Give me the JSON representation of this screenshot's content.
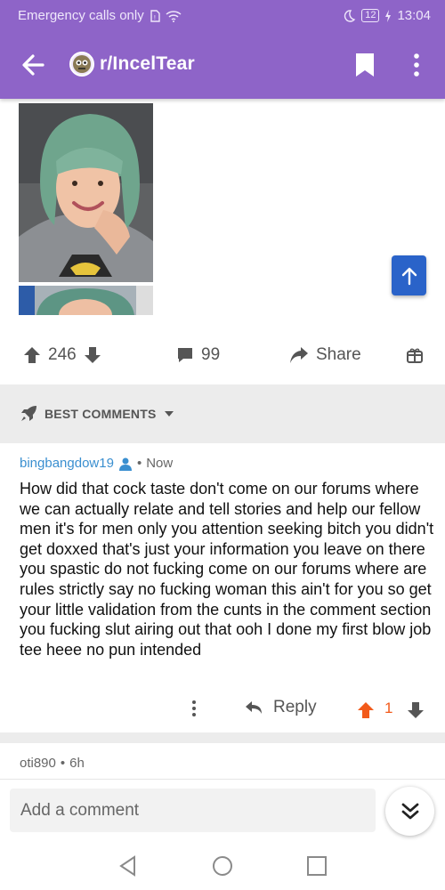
{
  "status_bar": {
    "carrier": "Emergency calls only",
    "battery": "12",
    "time": "13:04"
  },
  "header": {
    "subreddit": "r/IncelTear",
    "accent_color": "#8e64c8"
  },
  "post": {
    "upvotes": "246",
    "comments": "99",
    "share_label": "Share"
  },
  "sort": {
    "label": "BEST COMMENTS"
  },
  "comments": [
    {
      "author": "bingbangdow19",
      "time": "Now",
      "body": "How did that cock taste don't come on our forums where we can actually relate and tell stories and help our fellow men it's for men only you attention seeking bitch you didn't get doxxed that's just your information you leave on there you spastic do not fucking come on our forums where are rules strictly say no fucking woman this ain't for you so get your little validation from the cunts in the comment section you fucking slut airing out that ooh I done my first blow job tee heee no pun intended",
      "reply_label": "Reply",
      "score": "1"
    },
    {
      "author": "oti890",
      "time": "6h"
    }
  ],
  "composer": {
    "placeholder": "Add a comment"
  },
  "icons": [
    "back-arrow-icon",
    "bookmark-icon",
    "more-vertical-icon",
    "arrow-up-icon",
    "upvote-icon",
    "downvote-icon",
    "comment-icon",
    "share-icon",
    "gift-icon",
    "rocket-icon",
    "caret-down-icon",
    "user-icon",
    "reply-icon",
    "double-chevron-down-icon",
    "nav-back-icon",
    "nav-home-icon",
    "nav-recents-icon"
  ]
}
